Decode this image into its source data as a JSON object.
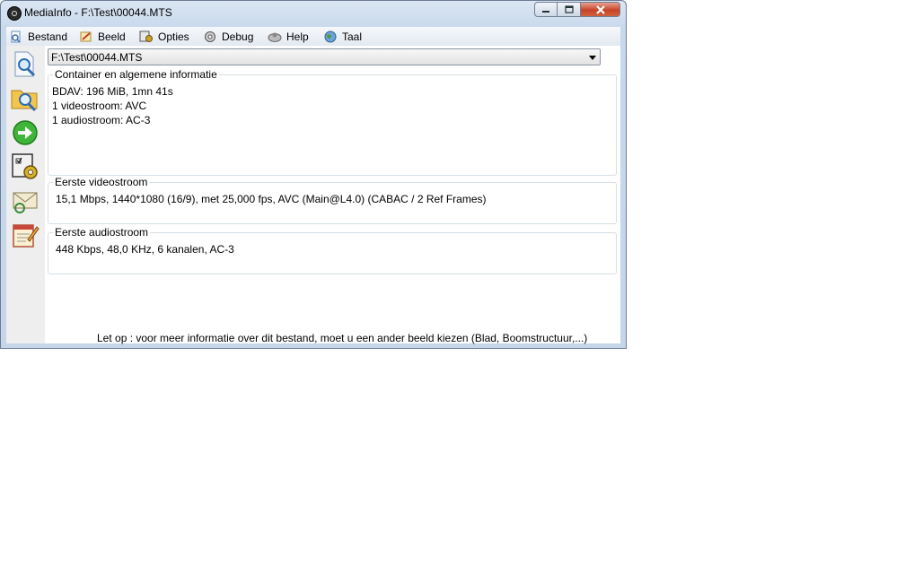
{
  "window": {
    "title": "MediaInfo - F:\\Test\\00044.MTS",
    "app_icon": "mediainfo-icon",
    "controls": {
      "minimize": "–",
      "maximize": "▫",
      "close": "✕"
    }
  },
  "menu": [
    {
      "label": "Bestand",
      "icon": "open-file-icon"
    },
    {
      "label": "Beeld",
      "icon": "view-icon"
    },
    {
      "label": "Opties",
      "icon": "options-icon"
    },
    {
      "label": "Debug",
      "icon": "debug-icon"
    },
    {
      "label": "Help",
      "icon": "help-icon"
    },
    {
      "label": "Taal",
      "icon": "language-globe-icon"
    }
  ],
  "toolbar": [
    {
      "name": "open-file-icon"
    },
    {
      "name": "open-folder-icon"
    },
    {
      "name": "next-arrow-icon"
    },
    {
      "name": "preferences-icon"
    },
    {
      "name": "email-icon"
    },
    {
      "name": "notepad-icon"
    }
  ],
  "file_select": {
    "value": "F:\\Test\\00044.MTS"
  },
  "sections": {
    "container": {
      "title": "Container en algemene informatie",
      "lines": [
        "BDAV: 196 MiB, 1mn 41s",
        "1 videostroom: AVC",
        "1 audiostroom: AC-3"
      ]
    },
    "video": {
      "title": "Eerste videostroom",
      "lines": [
        "15,1 Mbps, 1440*1080 (16/9), met 25,000 fps, AVC (Main@L4.0) (CABAC / 2 Ref Frames)"
      ]
    },
    "audio": {
      "title": "Eerste audiostroom",
      "lines": [
        "448 Kbps, 48,0 KHz, 6 kanalen, AC-3"
      ]
    }
  },
  "footer": {
    "note": "Let op : voor meer informatie over dit bestand, moet u een ander beeld kiezen (Blad, Boomstructuur,...)"
  }
}
